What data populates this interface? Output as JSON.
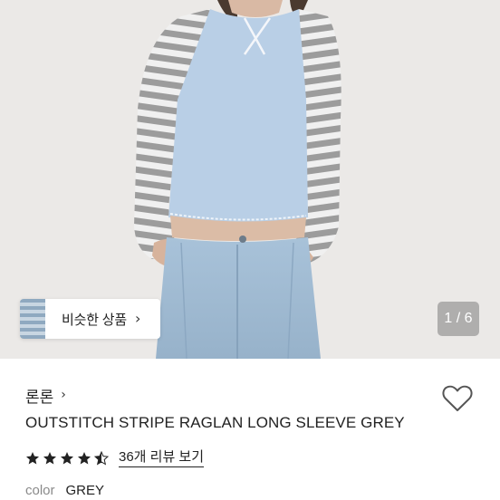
{
  "product_image": {
    "alt_icon": "product-photo",
    "colors": {
      "background": "#eceae8",
      "body": "#b9cfe6",
      "stripe_light": "#f2f2f2",
      "stripe_dark": "#9a9a9a",
      "jeans": "#a9c0d6",
      "skin": "#d9b9a4"
    }
  },
  "similar_products": {
    "label": "비슷한 상품",
    "arrow": "›"
  },
  "pager": {
    "current": 1,
    "total": 6,
    "text": "1 / 6"
  },
  "brand": {
    "name": "론론",
    "arrow": "›"
  },
  "product": {
    "title": "OUTSTITCH STRIPE RAGLAN LONG SLEEVE GREY"
  },
  "rating": {
    "stars": 4.5,
    "max": 5,
    "star_color": "#222222",
    "review_link": "36개 리뷰 보기"
  },
  "option": {
    "label": "color",
    "value": "GREY"
  },
  "wish": {
    "icon": "heart-outline-icon"
  }
}
